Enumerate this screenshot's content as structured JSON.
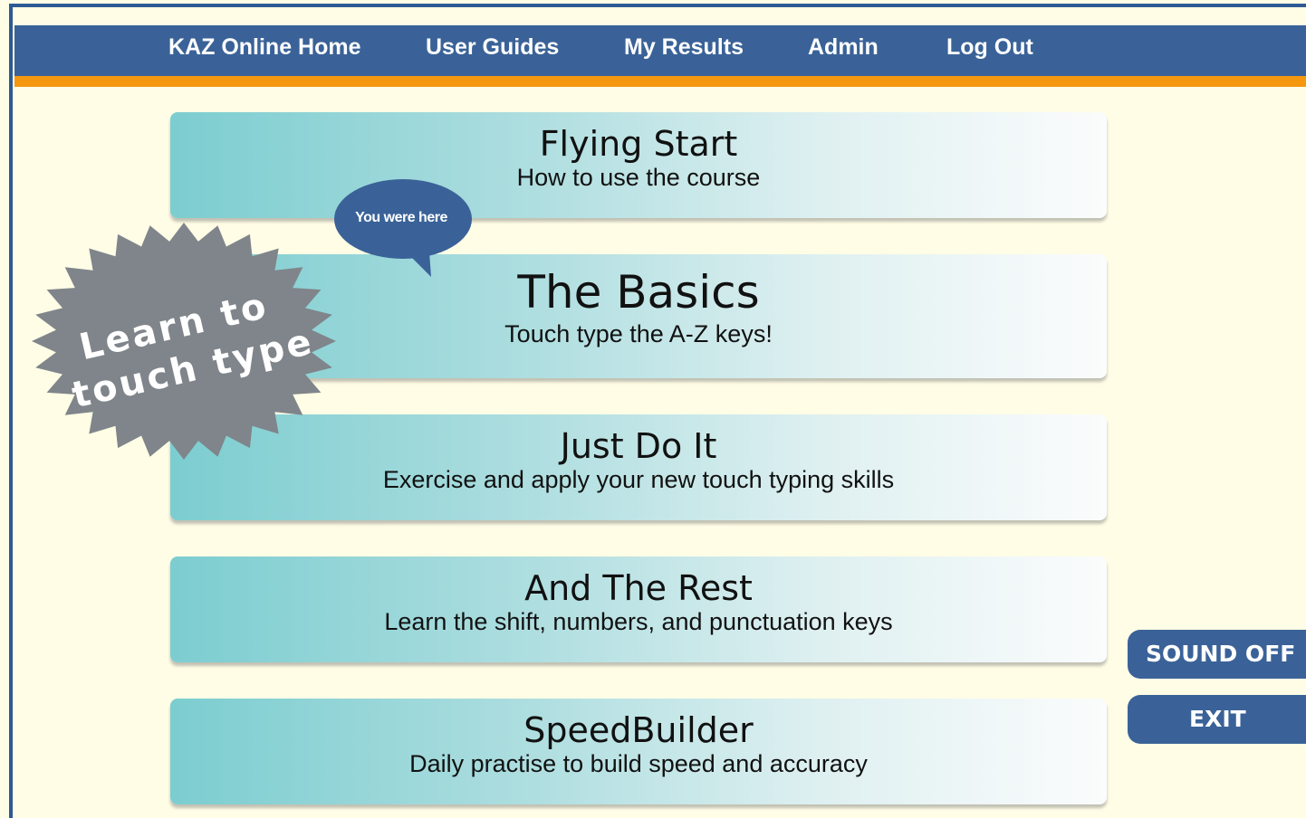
{
  "nav": {
    "items": [
      "KAZ Online Home",
      "User Guides",
      "My Results",
      "Admin",
      "Log Out"
    ]
  },
  "colors": {
    "nav_bg": "#3a6298",
    "nav_accent": "#f5980f",
    "page_bg": "#fffde6",
    "card_gradient_start": "#7ccdd0",
    "badge_gray": "#7f858a"
  },
  "badge": {
    "line1": "Learn to",
    "line2": "touch type"
  },
  "bubble": {
    "text": "You were here"
  },
  "modules": [
    {
      "title": "Flying Start",
      "subtitle": "How to use the course"
    },
    {
      "title": "The Basics",
      "subtitle": "Touch type the A-Z keys!"
    },
    {
      "title": "Just Do It",
      "subtitle": "Exercise and apply your new touch typing skills"
    },
    {
      "title": "And The Rest",
      "subtitle": "Learn the shift, numbers, and punctuation keys"
    },
    {
      "title": "SpeedBuilder",
      "subtitle": "Daily practise to build speed and accuracy"
    }
  ],
  "controls": {
    "sound": "SOUND OFF",
    "exit": "EXIT"
  }
}
